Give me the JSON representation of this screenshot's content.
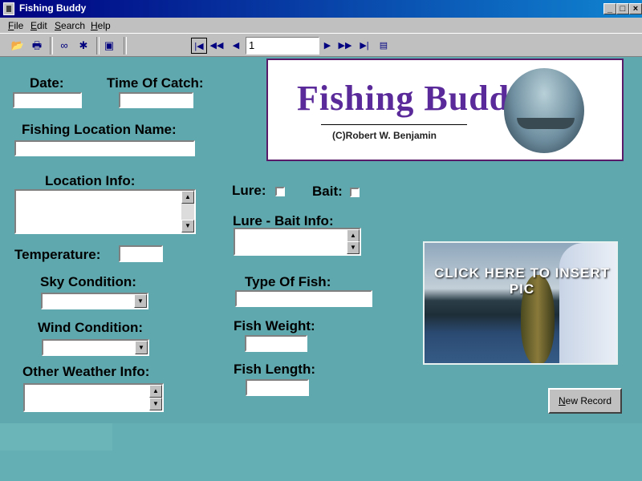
{
  "window": {
    "title": "Fishing Buddy"
  },
  "menu": {
    "items": [
      "File",
      "Edit",
      "Search",
      "Help"
    ]
  },
  "toolbar": {
    "icons": [
      "open-folder-icon",
      "print-icon",
      "binoculars-icon",
      "tools-icon",
      "calculator-icon"
    ]
  },
  "navigator": {
    "record_number": "1"
  },
  "logo": {
    "title": "Fishing Buddy",
    "copyright": "(C)Robert W. Benjamin"
  },
  "form": {
    "date_label": "Date:",
    "time_label": "Time Of Catch:",
    "location_name_label": "Fishing Location Name:",
    "location_info_label": "Location Info:",
    "temperature_label": "Temperature:",
    "sky_label": "Sky Condition:",
    "wind_label": "Wind Condition:",
    "other_weather_label": "Other Weather Info:",
    "lure_label": "Lure:",
    "bait_label": "Bait:",
    "lure_bait_info_label": "Lure - Bait Info:",
    "fish_type_label": "Type Of Fish:",
    "fish_weight_label": "Fish Weight:",
    "fish_length_label": "Fish Length:"
  },
  "photo": {
    "caption": "CLICK HERE TO INSERT PIC"
  },
  "buttons": {
    "new_record": "New Record"
  }
}
